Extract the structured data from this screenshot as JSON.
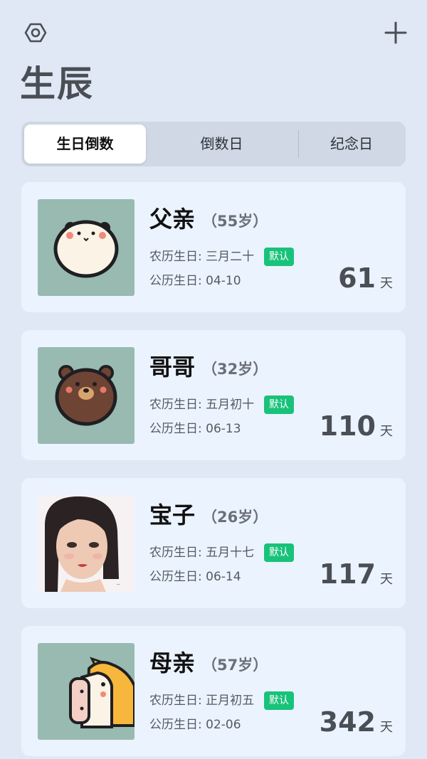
{
  "header": {
    "title": "生辰",
    "settings_icon": "hexagon-settings-icon",
    "add_icon": "plus-icon"
  },
  "tabs": [
    {
      "label": "生日倒数",
      "active": true
    },
    {
      "label": "倒数日",
      "active": false
    },
    {
      "label": "纪念日",
      "active": false
    }
  ],
  "colors": {
    "background": "#dfe8f4",
    "card": "#ebf3fe",
    "badge": "#19c27a",
    "avatar_bg": "#98bab0"
  },
  "people": [
    {
      "name": "父亲",
      "age": "（55岁）",
      "lunar": "农历生日: 三月二十",
      "badge": "默认",
      "solar": "公历生日: 04-10",
      "days": "61",
      "days_unit": "天",
      "avatar": "panda-avatar"
    },
    {
      "name": "哥哥",
      "age": "（32岁）",
      "lunar": "农历生日: 五月初十",
      "badge": "默认",
      "solar": "公历生日: 06-13",
      "days": "110",
      "days_unit": "天",
      "avatar": "brown-bear-avatar"
    },
    {
      "name": "宝子",
      "age": "（26岁）",
      "lunar": "农历生日: 五月十七",
      "badge": "默认",
      "solar": "公历生日: 06-14",
      "days": "117",
      "days_unit": "天",
      "avatar": "girl-portrait-avatar"
    },
    {
      "name": "母亲",
      "age": "（57岁）",
      "lunar": "农历生日: 正月初五",
      "badge": "默认",
      "solar": "公历生日: 02-06",
      "days": "342",
      "days_unit": "天",
      "avatar": "horse-avatar"
    }
  ]
}
